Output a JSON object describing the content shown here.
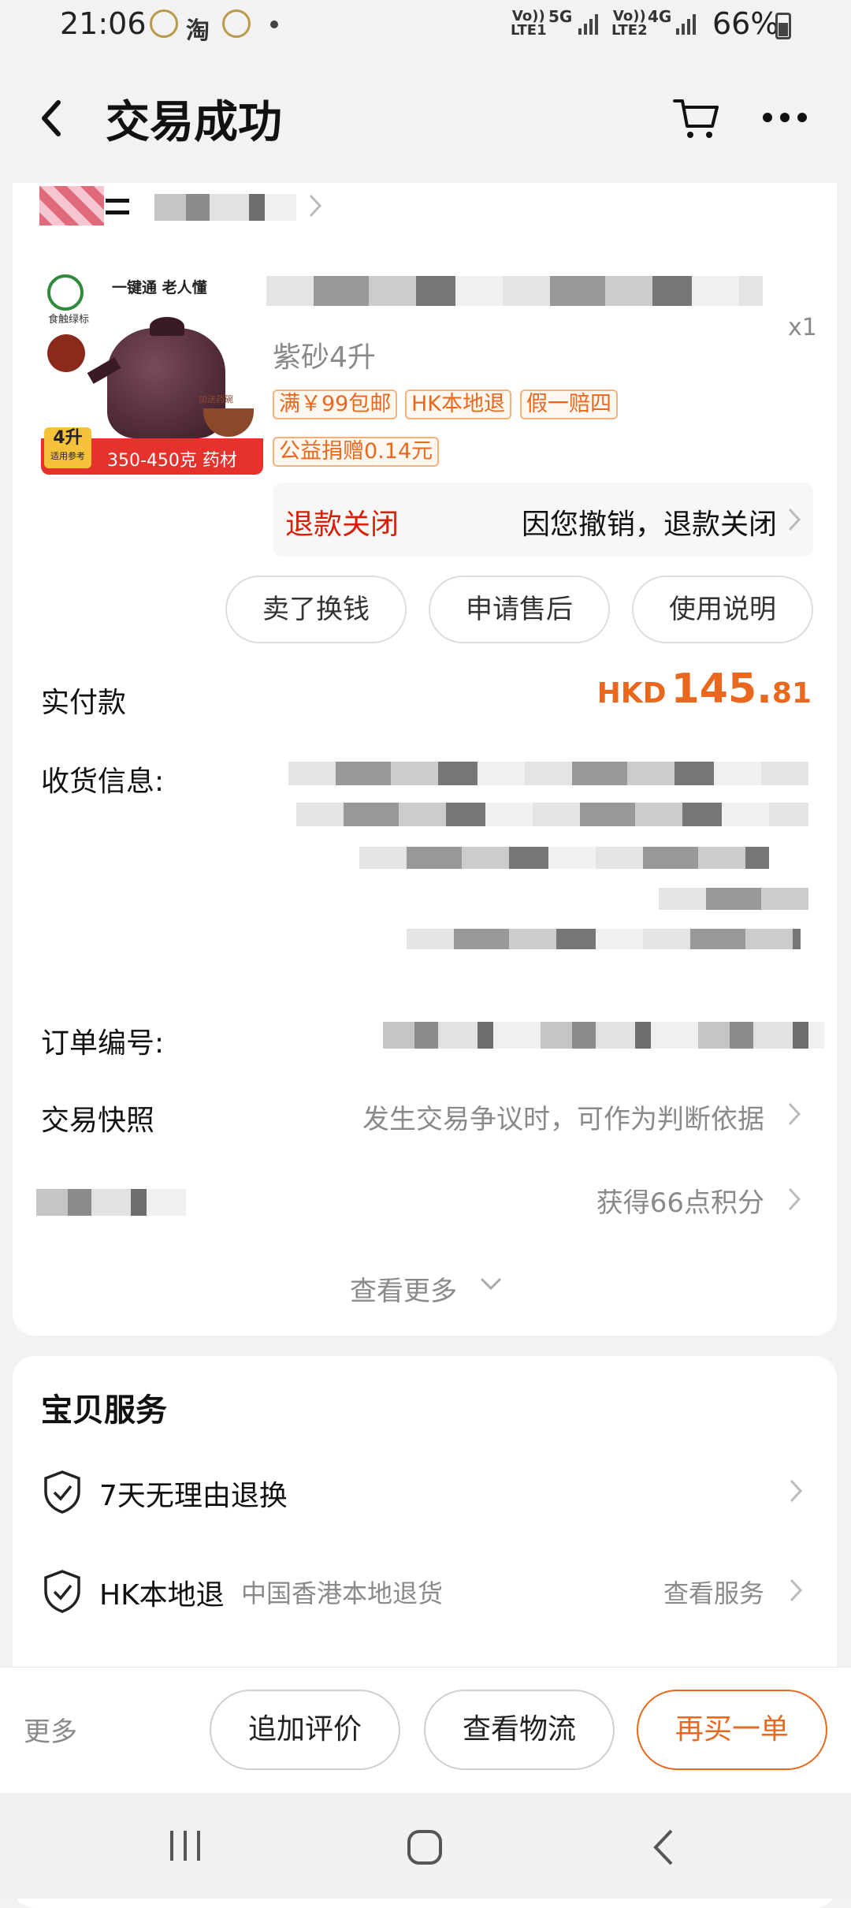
{
  "status_bar": {
    "time": "21:06",
    "app_icons": [
      "oncc-icon",
      "taobao-icon",
      "oncc-icon"
    ],
    "taobao_glyph": "淘",
    "sim1_top": "Vo))",
    "sim1_bottom": "LTE1",
    "net1": "5G",
    "sim2_top": "Vo))",
    "sim2_bottom": "LTE2",
    "net2": "4G",
    "battery": "66%"
  },
  "header": {
    "title": "交易成功"
  },
  "product": {
    "image_labels": {
      "top_text": "一键通 老人懂",
      "badge_text": "食触绿标",
      "capacity": "4升",
      "capacity_sub": "适用参考",
      "weight": "350-450克 药材",
      "bowl_text": "加送药碗"
    },
    "spec": "紫砂4升",
    "quantity": "x1",
    "tags": [
      "满￥99包邮",
      "HK本地退",
      "假一赔四"
    ],
    "charity_tag": "公益捐赠0.14元",
    "refund_status": "退款关闭",
    "refund_reason": "因您撤销，退款关闭"
  },
  "actions": [
    "卖了换钱",
    "申请售后",
    "使用说明"
  ],
  "payment": {
    "label": "实付款",
    "currency": "HKD",
    "amount_int": "145.",
    "amount_dec": "81"
  },
  "shipping": {
    "label": "收货信息:"
  },
  "order_number": {
    "label": "订单编号:"
  },
  "snapshot": {
    "label": "交易快照",
    "hint": "发生交易争议时，可作为判断依据"
  },
  "points": {
    "text": "获得66点积分"
  },
  "see_more": "查看更多",
  "services": {
    "title": "宝贝服务",
    "items": [
      {
        "label": "7天无理由退换",
        "sub": "",
        "action": ""
      },
      {
        "label": "HK本地退",
        "sub": "中国香港本地退货",
        "action": "查看服务"
      }
    ]
  },
  "bottom_bar": {
    "more": "更多",
    "buttons": [
      "追加评价",
      "查看物流",
      "再买一单"
    ]
  },
  "colors": {
    "accent": "#e9681e",
    "refund_red": "#d81e06",
    "background": "#f2f2f2"
  }
}
